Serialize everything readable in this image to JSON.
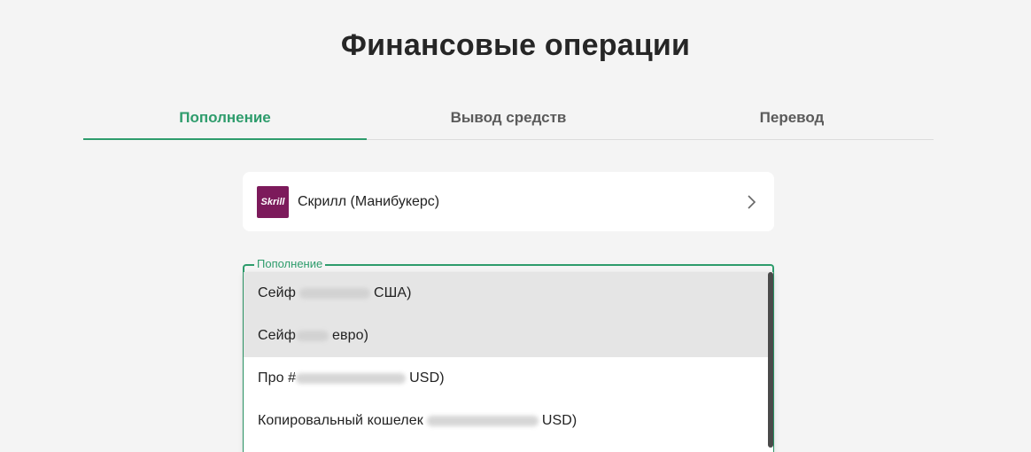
{
  "title": "Финансовые операции",
  "tabs": [
    {
      "label": "Пополнение",
      "active": true
    },
    {
      "label": "Вывод средств",
      "active": false
    },
    {
      "label": "Перевод",
      "active": false
    }
  ],
  "payment_method": {
    "logo_text": "Skrill",
    "label": "Скрилл (Манибукерс)",
    "icon": "chevron-right-icon"
  },
  "deposit_field": {
    "legend": "Пополнение",
    "options": [
      {
        "prefix": "Сейф",
        "suffix": "США)"
      },
      {
        "prefix": "Сейф",
        "suffix": "евро)"
      },
      {
        "prefix": "Про #",
        "suffix": "USD)"
      },
      {
        "prefix": "Копировальный кошелек",
        "suffix": "USD)"
      }
    ]
  },
  "colors": {
    "accent": "#2e9c6c",
    "skrill_brand": "#7c1a5b",
    "background": "#f4f4f4",
    "highlight": "#e5e5e5"
  }
}
